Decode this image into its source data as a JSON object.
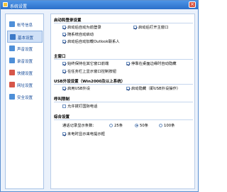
{
  "window": {
    "title": "系统设置",
    "close_glyph": "×"
  },
  "sidebar": {
    "items": [
      {
        "label": "帐号信息",
        "icon": "user-icon",
        "color": "#4e8fd8"
      },
      {
        "label": "基本设置",
        "icon": "settings-icon",
        "color": "#3c79c7",
        "active": true
      },
      {
        "label": "声音设置",
        "icon": "sound-icon",
        "color": "#4e8fd8"
      },
      {
        "label": "录音设置",
        "icon": "record-icon",
        "color": "#4e8fd8"
      },
      {
        "label": "快捷设置",
        "icon": "shortcut-icon",
        "color": "#d6564a"
      },
      {
        "label": "网址设置",
        "icon": "web-icon",
        "color": "#d6564a"
      },
      {
        "label": "安全设置",
        "icon": "security-icon",
        "color": "#4e8fd8"
      }
    ]
  },
  "startup": {
    "title": "启动和登录设置",
    "opt1": "启动后自动为前登录",
    "opt2": "启动后打开主窗口",
    "opt3": "随系统自动启动",
    "opt4": "启动后自动加载Outlook联系人"
  },
  "mainwin": {
    "title": "主窗口",
    "opt1": "始终保持在其它窗口前端",
    "opt2": "停靠在桌面边缘时自动隐藏",
    "opt3": "在任务栏上显示窗口控制按钮"
  },
  "hotkey": {
    "title": "USB外设设置（Win2000及以上系统）",
    "opt1": "启用USB外设",
    "opt2": "启动隐藏（即USB外设操作）"
  },
  "call": {
    "title": "呼叫限制",
    "opt1": "允许拨打国际电话"
  },
  "misc": {
    "title": "综合设置",
    "records_label": "通话记录显示条数：",
    "r25": "25条",
    "r50": "50条",
    "r100": "100条",
    "opt1": "未电时显示来电提示框"
  }
}
